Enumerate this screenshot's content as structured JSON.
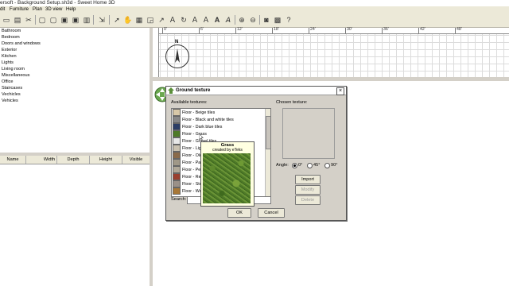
{
  "window": {
    "title": "ersoft - Background Setup.sh3d - Sweet Home 3D"
  },
  "menu": {
    "items": [
      "dit",
      "Furniture",
      "Plan",
      "3D view",
      "Help"
    ]
  },
  "catalog": {
    "categories": [
      "Bathroom",
      "Bedroom",
      "Doors and windows",
      "Exterior",
      "Kitchen",
      "Lights",
      "Living room",
      "Miscellaneous",
      "Office",
      "Staircases",
      "Vechicles",
      "Vehicles"
    ]
  },
  "furniture_table": {
    "columns": [
      "Name",
      "Width",
      "Depth",
      "Height",
      "Visible"
    ]
  },
  "plan": {
    "ruler_labels": [
      "0'",
      "6'",
      "12'",
      "18'",
      "24'",
      "30'",
      "36'",
      "42'",
      "48'"
    ],
    "compass_label": "N"
  },
  "dialog": {
    "title": "Ground texture",
    "available_label": "Available textures:",
    "chosen_label": "Chosen texture:",
    "textures": [
      {
        "name": "Floor - Beige tiles",
        "color": "#d8c8a8"
      },
      {
        "name": "Floor - Black and white tiles",
        "color": "#888888"
      },
      {
        "name": "Floor - Dark blue tiles",
        "color": "#2c3e66"
      },
      {
        "name": "Floor - Grass",
        "color": "#4e7a27"
      },
      {
        "name": "Floor - Gravel tiles",
        "color": "#e8e8e8"
      },
      {
        "name": "Floor - Ligh",
        "color": "#c9c1b0"
      },
      {
        "name": "Floor - Old",
        "color": "#8a6a4a"
      },
      {
        "name": "Floor - Pav",
        "color": "#a09888"
      },
      {
        "name": "Floor - Peb",
        "color": "#b0a898"
      },
      {
        "name": "Floor - Red",
        "color": "#9a4030"
      },
      {
        "name": "Floor - Stor",
        "color": "#9a9088"
      },
      {
        "name": "Floor - Woo",
        "color": "#a87838"
      }
    ],
    "angle_label": "Angle:",
    "angle_options": [
      "0°",
      "45°",
      "90°"
    ],
    "angle_selected": "0°",
    "import_label": "Import",
    "modify_label": "Modify",
    "delete_label": "Delete",
    "search_label": "Search:",
    "ok_label": "OK",
    "cancel_label": "Cancel"
  },
  "tooltip": {
    "title": "Grass",
    "subtitle": "created by eTeks"
  }
}
